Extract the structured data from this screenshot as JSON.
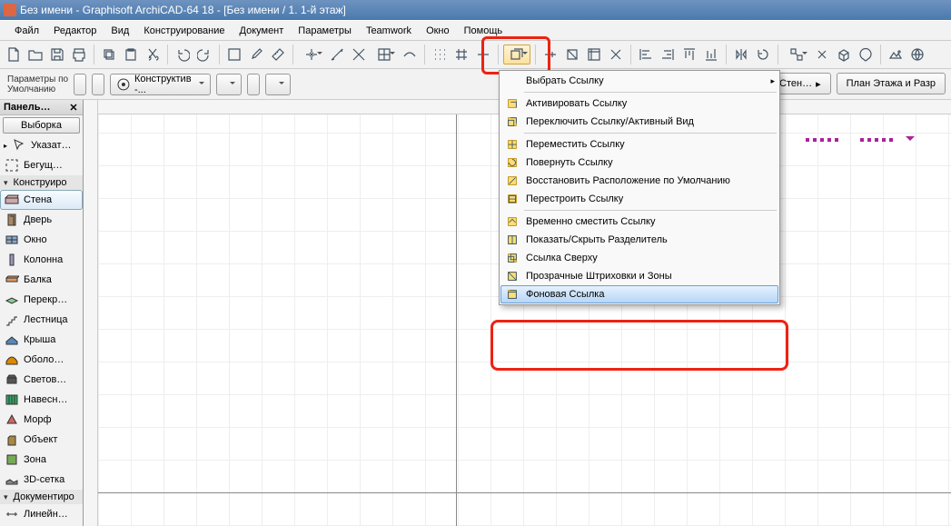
{
  "title": "Без имени - Graphisoft ArchiCAD-64 18 - [Без имени / 1. 1-й этаж]",
  "menus": [
    "Файл",
    "Редактор",
    "Вид",
    "Конструирование",
    "Документ",
    "Параметры",
    "Teamwork",
    "Окно",
    "Помощь"
  ],
  "toolbar_icons": [
    "new-file",
    "open-file",
    "save-file",
    "print",
    "|",
    "copy",
    "paste",
    "cut",
    "|",
    "undo",
    "redo",
    "|",
    "marquee",
    "eye-dropper",
    "measure",
    "|",
    "snap-point:dd",
    "snap-endpoint",
    "snap-intersect",
    "snap-grid:dd",
    "snap-surface",
    "|",
    "grid-dots",
    "grid-lines",
    "grid-axis",
    "|",
    "trace-ref:dd:main",
    "|",
    "section-line",
    "section-detail",
    "section-worksheet",
    "section-marker",
    "|",
    "align-left",
    "align-right",
    "align-top",
    "align-bottom",
    "|",
    "mirror",
    "rotate",
    "|",
    "group:dd",
    "explode",
    "extrude",
    "color",
    "|",
    "render",
    "gl"
  ],
  "info": {
    "default_label": "Параметры по\nУмолчанию",
    "construct_label": "Конструктив -...",
    "nav_wall": "…ая Стен…",
    "nav_plan": "План Этажа и Разр"
  },
  "panel": {
    "title": "Панель…",
    "selection": "Выборка",
    "tools": [
      {
        "label": "Указат…",
        "icon": "cursor",
        "group": true,
        "gr": "r"
      },
      {
        "label": "Бегущ…",
        "icon": "marquee",
        "group": false
      },
      {
        "label": "Конструиро",
        "icon": "",
        "group": true,
        "gr": "d",
        "cat": true
      },
      {
        "label": "Стена",
        "icon": "wall",
        "selected": true
      },
      {
        "label": "Дверь",
        "icon": "door"
      },
      {
        "label": "Окно",
        "icon": "window"
      },
      {
        "label": "Колонна",
        "icon": "column"
      },
      {
        "label": "Балка",
        "icon": "beam"
      },
      {
        "label": "Перекр…",
        "icon": "slab"
      },
      {
        "label": "Лестница",
        "icon": "stair"
      },
      {
        "label": "Крыша",
        "icon": "roof"
      },
      {
        "label": "Оболо…",
        "icon": "shell"
      },
      {
        "label": "Светов…",
        "icon": "skylight"
      },
      {
        "label": "Навесн…",
        "icon": "curtain"
      },
      {
        "label": "Морф",
        "icon": "morph"
      },
      {
        "label": "Объект",
        "icon": "object"
      },
      {
        "label": "Зона",
        "icon": "zone"
      },
      {
        "label": "3D-сетка",
        "icon": "mesh"
      },
      {
        "label": "Документиро",
        "icon": "",
        "group": true,
        "gr": "d",
        "cat": true
      },
      {
        "label": "Линейн…",
        "icon": "dim"
      }
    ]
  },
  "dropdown": {
    "header": "Выбрать Ссылку",
    "items": [
      {
        "label": "Активировать Ссылку",
        "icon": "activate"
      },
      {
        "label": "Переключить Ссылку/Активный Вид",
        "icon": "switch"
      },
      {
        "sep": true
      },
      {
        "label": "Переместить Ссылку",
        "icon": "move"
      },
      {
        "label": "Повернуть Ссылку",
        "icon": "rotate"
      },
      {
        "label": "Восстановить Расположение по Умолчанию",
        "icon": "reset"
      },
      {
        "label": "Перестроить Ссылку",
        "icon": "rebuild"
      },
      {
        "sep": true
      },
      {
        "label": "Временно сместить Ссылку",
        "icon": "displace"
      },
      {
        "label": "Показать/Скрыть Разделитель",
        "icon": "splitter"
      },
      {
        "label": "Ссылка Сверху",
        "icon": "ontop"
      },
      {
        "label": "Прозрачные Штриховки и Зоны",
        "icon": "transp"
      },
      {
        "label": "Фоновая Ссылка",
        "icon": "bg",
        "selected": true
      }
    ]
  }
}
